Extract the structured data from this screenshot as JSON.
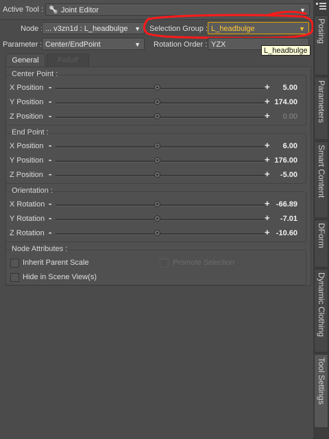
{
  "header": {
    "active_tool_label": "Active Tool :",
    "active_tool_value": "Joint Editor",
    "icon": "joint-editor-icon"
  },
  "node": {
    "label": "Node :",
    "value": "... v3zn1d : L_headbulge"
  },
  "selection_group": {
    "label": "Selection Group :",
    "value": "L_headbulge",
    "tooltip": "L_headbulge",
    "highlight_color": "#ff1a1a",
    "value_color": "#ffc933"
  },
  "parameter": {
    "label": "Parameter :",
    "value": "Center/EndPoint"
  },
  "rotation_order": {
    "label": "Rotation Order :",
    "value": "YZX"
  },
  "tabs": [
    {
      "label": "General"
    },
    {
      "label": "Falloff"
    }
  ],
  "groups": {
    "center_point": {
      "title": "Center Point :",
      "rows": [
        {
          "label": "X Position",
          "value": "5.00"
        },
        {
          "label": "Y Position",
          "value": "174.00"
        },
        {
          "label": "Z Position",
          "value": "0.00"
        }
      ]
    },
    "end_point": {
      "title": "End Point :",
      "rows": [
        {
          "label": "X Position",
          "value": "6.00"
        },
        {
          "label": "Y Position",
          "value": "176.00"
        },
        {
          "label": "Z Position",
          "value": "-5.00"
        }
      ]
    },
    "orientation": {
      "title": "Orientation :",
      "rows": [
        {
          "label": "X Rotation",
          "value": "-66.89"
        },
        {
          "label": "Y Rotation",
          "value": "-7.01"
        },
        {
          "label": "Z Rotation",
          "value": "-10.60"
        }
      ]
    },
    "node_attributes": {
      "title": "Node Attributes :",
      "inherit_parent_scale": "Inherit Parent Scale",
      "promote_selection": "Promote Selection",
      "hide_in_scene_view": "Hide in Scene View(s)"
    }
  },
  "side_tabs": [
    {
      "label": "Posing"
    },
    {
      "label": "Parameters"
    },
    {
      "label": "Smart Content"
    },
    {
      "label": "DForm"
    },
    {
      "label": "Dynamic Clothing"
    },
    {
      "label": "Tool Settings"
    }
  ]
}
